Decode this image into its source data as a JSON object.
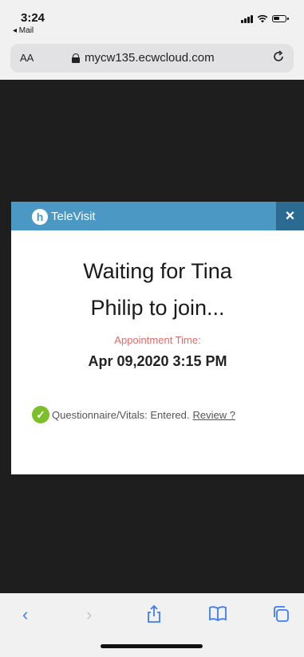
{
  "status_bar": {
    "time": "3:24",
    "back_app": "◂ Mail"
  },
  "url_bar": {
    "text_size": "AA",
    "url": "mycw135.ecwcloud.com"
  },
  "modal": {
    "title": "TeleVisit",
    "close_label": "×",
    "waiting_line1": "Waiting for  Tina",
    "waiting_line2": "Philip to join...",
    "appointment_label": "Appointment Time:",
    "appointment_time": "Apr 09,2020 3:15 PM",
    "questionnaire_text": "Questionnaire/Vitals: Entered.",
    "review_link": "Review ?"
  },
  "toolbar": {
    "back": "‹",
    "forward": "›"
  },
  "colors": {
    "header": "#4b98c4",
    "close": "#2b6b92",
    "accent_red": "#e86a6a",
    "check_green": "#7cbf2a",
    "ios_blue": "#3c7df6"
  }
}
